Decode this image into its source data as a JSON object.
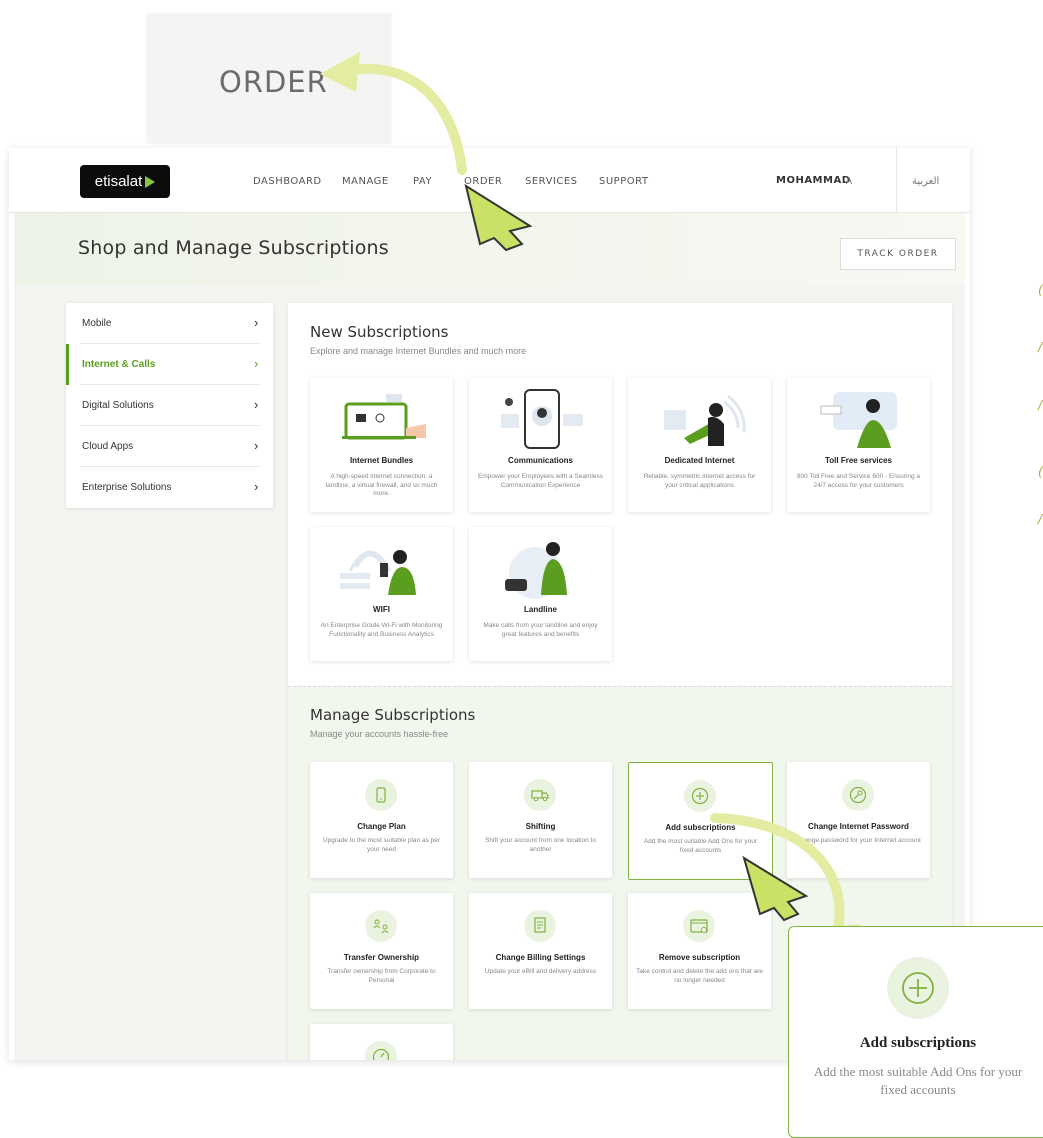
{
  "zoom_top": {
    "label": "ORDER"
  },
  "header": {
    "logo_text": "etisalat",
    "nav": [
      "DASHBOARD",
      "MANAGE",
      "PAY",
      "ORDER",
      "SERVICES",
      "SUPPORT"
    ],
    "user_name": "MOHAMMAD",
    "user_initial": "A",
    "language": "العربية"
  },
  "banner": {
    "title": "Shop and Manage Subscriptions",
    "track_order": "TRACK ORDER"
  },
  "sidebar": {
    "items": [
      {
        "label": "Mobile",
        "active": false
      },
      {
        "label": "Internet & Calls",
        "active": true
      },
      {
        "label": "Digital Solutions",
        "active": false
      },
      {
        "label": "Cloud Apps",
        "active": false
      },
      {
        "label": "Enterprise Solutions",
        "active": false
      }
    ],
    "chevron": "›"
  },
  "new_subscriptions": {
    "title": "New Subscriptions",
    "subtitle": "Explore and manage Internet Bundles and much more",
    "cards": [
      {
        "title": "Internet Bundles",
        "desc": "A high-speed internet connection, a landline, a virtual firewall, and so much more."
      },
      {
        "title": "Communications",
        "desc": "Empower your Employees with a Seamless Communication Experience"
      },
      {
        "title": "Dedicated Internet",
        "desc": "Reliable, symmetric internet access for your critical applications"
      },
      {
        "title": "Toll Free services",
        "desc": "800 Toll Free and Service 600 - Ensuring a 24/7 access for your customers"
      },
      {
        "title": "WIFI",
        "desc": "An Enterprise Grade Wi-Fi with Monitoring Functionality and Business Analytics"
      },
      {
        "title": "Landline",
        "desc": "Make calls from your landline and enjoy great features and benefits"
      }
    ]
  },
  "manage_subscriptions": {
    "title": "Manage Subscriptions",
    "subtitle": "Manage your accounts hassle-free",
    "cards": [
      {
        "title": "Change Plan",
        "desc": "Upgrade to the most suitable plan as per your need",
        "icon": "phone-icon"
      },
      {
        "title": "Shifting",
        "desc": "Shift your account from one location to another",
        "icon": "truck-icon"
      },
      {
        "title": "Add subscriptions",
        "desc": "Add the most suitable Add Ons for your fixed accounts",
        "icon": "plus-circle-icon"
      },
      {
        "title": "Change Internet Password",
        "desc": "Change password for your Internet account",
        "icon": "key-icon"
      },
      {
        "title": "Transfer Ownership",
        "desc": "Transfer ownership from Corporate to Personal",
        "icon": "users-icon"
      },
      {
        "title": "Change Billing Settings",
        "desc": "Update your eBill and delivery address",
        "icon": "bill-icon"
      },
      {
        "title": "Remove subscription",
        "desc": "Take control and delete the add ons that are no longer needed",
        "icon": "window-icon"
      }
    ]
  },
  "zoom_bottom": {
    "title": "Add subscriptions",
    "desc": "Add the most suitable Add Ons for your fixed accounts"
  },
  "colors": {
    "accent": "#7fb241",
    "active_green": "#5b9e1f",
    "arrow": "#e3eca0"
  }
}
